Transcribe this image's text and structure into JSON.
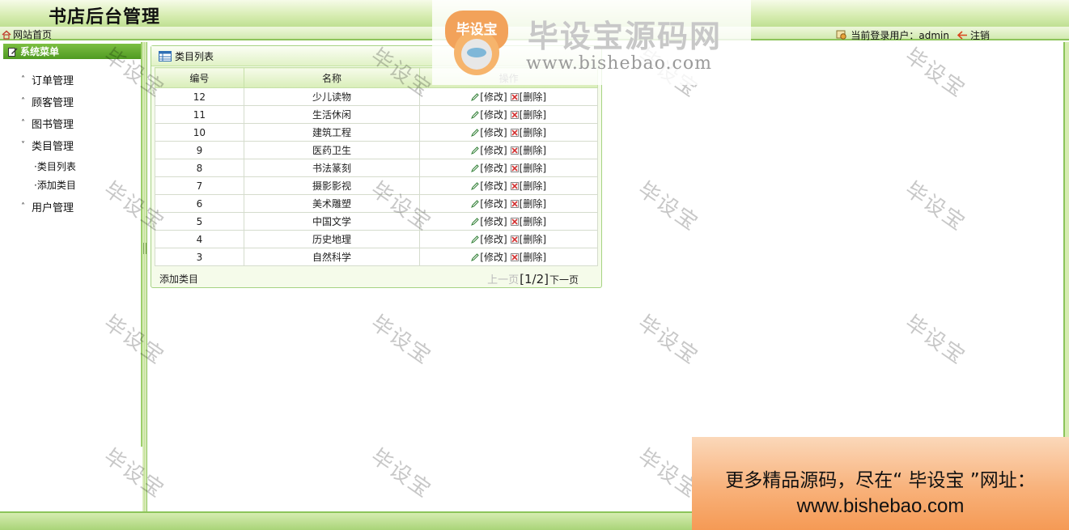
{
  "header": {
    "title": "书店后台管理"
  },
  "subbar": {
    "home_label": "网站首页",
    "user_label": "当前登录用户：admin",
    "logout_label": "注销"
  },
  "sidebar": {
    "title": "系统菜单",
    "groups": [
      {
        "label": "订单管理",
        "expanded": false
      },
      {
        "label": "顾客管理",
        "expanded": false
      },
      {
        "label": "图书管理",
        "expanded": false
      },
      {
        "label": "类目管理",
        "expanded": true
      },
      {
        "label": "用户管理",
        "expanded": false
      }
    ],
    "sub_items": [
      "类目列表",
      "添加类目"
    ]
  },
  "panel": {
    "title": "类目列表",
    "columns": [
      "编号",
      "名称",
      "操作"
    ],
    "rows": [
      {
        "id": "12",
        "name": "少儿读物"
      },
      {
        "id": "11",
        "name": "生活休闲"
      },
      {
        "id": "10",
        "name": "建筑工程"
      },
      {
        "id": "9",
        "name": "医药卫生"
      },
      {
        "id": "8",
        "name": "书法篆刻"
      },
      {
        "id": "7",
        "name": "摄影影视"
      },
      {
        "id": "6",
        "name": "美术雕塑"
      },
      {
        "id": "5",
        "name": "中国文学"
      },
      {
        "id": "4",
        "name": "历史地理"
      },
      {
        "id": "3",
        "name": "自然科学"
      }
    ],
    "edit_label": "[修改]",
    "delete_label": "[删除]",
    "add_label": "添加类目",
    "pager": {
      "prev": "上一页",
      "page": "[1/2]",
      "next": "下一页"
    }
  },
  "watermark": {
    "logo_badge_text": "毕设宝",
    "logo_cn": "毕设宝源码网",
    "logo_url": "www.bishebao.com",
    "stamp_text": "毕设宝"
  },
  "promo": {
    "line1": "更多精品源码，尽在“ 毕设宝 ”网址：",
    "line2": "www.bishebao.com"
  },
  "colors": {
    "accent_green": "#8cc45a",
    "header_green": "#bfe093",
    "menu_head": "#4f9a22",
    "promo_orange": "#f59a55"
  }
}
